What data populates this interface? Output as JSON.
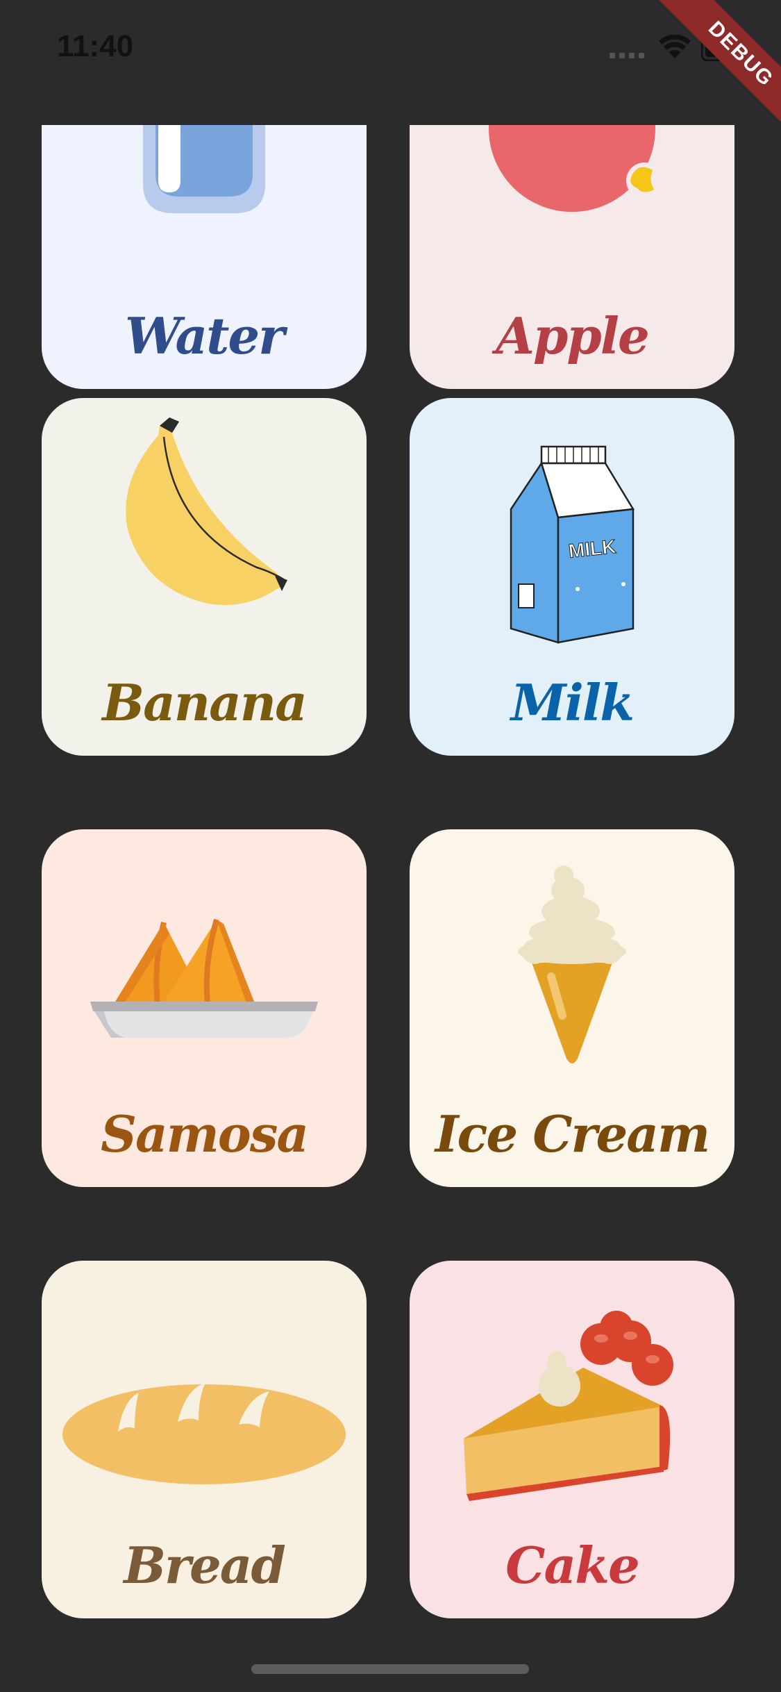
{
  "status_bar": {
    "time": "11:40"
  },
  "debug_banner": "DEBUG",
  "cards": [
    {
      "label": "Water",
      "bg": "#eef3fd",
      "color": "#2f4d8a",
      "icon": "water-glass-icon"
    },
    {
      "label": "Apple",
      "bg": "#f5e9ea",
      "color": "#b43f45",
      "icon": "apple-icon"
    },
    {
      "label": "Banana",
      "bg": "#f2f2ea",
      "color": "#7a5a0e",
      "icon": "banana-icon"
    },
    {
      "label": "Milk",
      "bg": "#e2f0fa",
      "color": "#0a63a8",
      "icon": "milk-carton-icon"
    },
    {
      "label": "Samosa",
      "bg": "#fde9e0",
      "color": "#9a5511",
      "icon": "samosa-icon"
    },
    {
      "label": "Ice Cream",
      "bg": "#fcf5ea",
      "color": "#7a4a0c",
      "icon": "ice-cream-icon"
    },
    {
      "label": "Bread",
      "bg": "#f8f0e1",
      "color": "#7b5a37",
      "icon": "bread-icon"
    },
    {
      "label": "Cake",
      "bg": "#f9e1e4",
      "color": "#c93a3e",
      "icon": "cake-icon"
    }
  ]
}
